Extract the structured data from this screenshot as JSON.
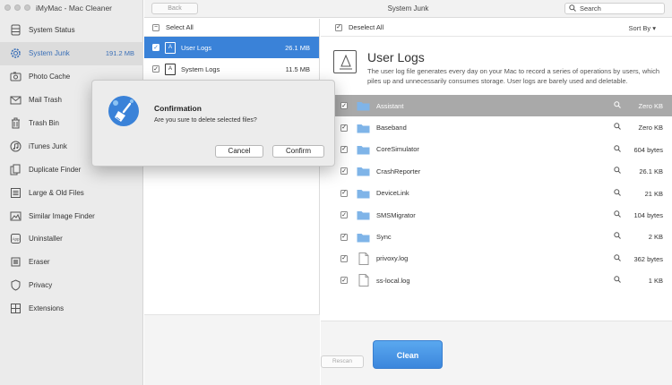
{
  "app": {
    "title": "iMyMac - Mac Cleaner"
  },
  "sidebar": {
    "items": [
      {
        "label": "System Status",
        "icon": "disk-icon",
        "size": ""
      },
      {
        "label": "System Junk",
        "icon": "gear-icon",
        "size": "191.2 MB",
        "active": true
      },
      {
        "label": "Photo Cache",
        "icon": "photo-icon",
        "size": ""
      },
      {
        "label": "Mail Trash",
        "icon": "mail-icon",
        "size": ""
      },
      {
        "label": "Trash Bin",
        "icon": "trash-icon",
        "size": ""
      },
      {
        "label": "iTunes Junk",
        "icon": "music-note-icon",
        "size": ""
      },
      {
        "label": "Duplicate Finder",
        "icon": "duplicate-icon",
        "size": ""
      },
      {
        "label": "Large & Old Files",
        "icon": "large-files-icon",
        "size": ""
      },
      {
        "label": "Similar Image Finder",
        "icon": "image-icon",
        "size": ""
      },
      {
        "label": "Uninstaller",
        "icon": "app-icon",
        "size": ""
      },
      {
        "label": "Eraser",
        "icon": "eraser-icon",
        "size": ""
      },
      {
        "label": "Privacy",
        "icon": "shield-icon",
        "size": ""
      },
      {
        "label": "Extensions",
        "icon": "extensions-icon",
        "size": ""
      }
    ]
  },
  "toolbar": {
    "back_label": "Back",
    "title": "System Junk",
    "search_placeholder": "Search"
  },
  "middle": {
    "select_all_label": "Select All",
    "categories": [
      {
        "name": "User Logs",
        "size": "26.1 MB",
        "active": true
      },
      {
        "name": "System Logs",
        "size": "11.5 MB",
        "active": false
      }
    ]
  },
  "details": {
    "deselect_all_label": "Deselect All",
    "sort_label": "Sort By",
    "title": "User Logs",
    "description": "The user log file generates every day on your Mac to record a series of operations by users, which piles up and unnecessarily consumes storage. User logs are barely used and deletable.",
    "files": [
      {
        "name": "Assistant",
        "size": "Zero KB",
        "type": "folder",
        "active": true
      },
      {
        "name": "Baseband",
        "size": "Zero KB",
        "type": "folder"
      },
      {
        "name": "CoreSimulator",
        "size": "604 bytes",
        "type": "folder"
      },
      {
        "name": "CrashReporter",
        "size": "26.1 KB",
        "type": "folder"
      },
      {
        "name": "DeviceLink",
        "size": "21 KB",
        "type": "folder"
      },
      {
        "name": "SMSMigrator",
        "size": "104 bytes",
        "type": "folder"
      },
      {
        "name": "Sync",
        "size": "2 KB",
        "type": "folder"
      },
      {
        "name": "privoxy.log",
        "size": "362 bytes",
        "type": "file"
      },
      {
        "name": "ss-local.log",
        "size": "1 KB",
        "type": "file"
      }
    ]
  },
  "actions": {
    "rescan_label": "Rescan",
    "clean_label": "Clean"
  },
  "dialog": {
    "title": "Confirmation",
    "message": "Are you sure to delete selected files?",
    "cancel_label": "Cancel",
    "confirm_label": "Confirm"
  },
  "colors": {
    "accent": "#3a82d8",
    "folder": "#7fb4e8",
    "selected_row": "#a9a9a9"
  }
}
